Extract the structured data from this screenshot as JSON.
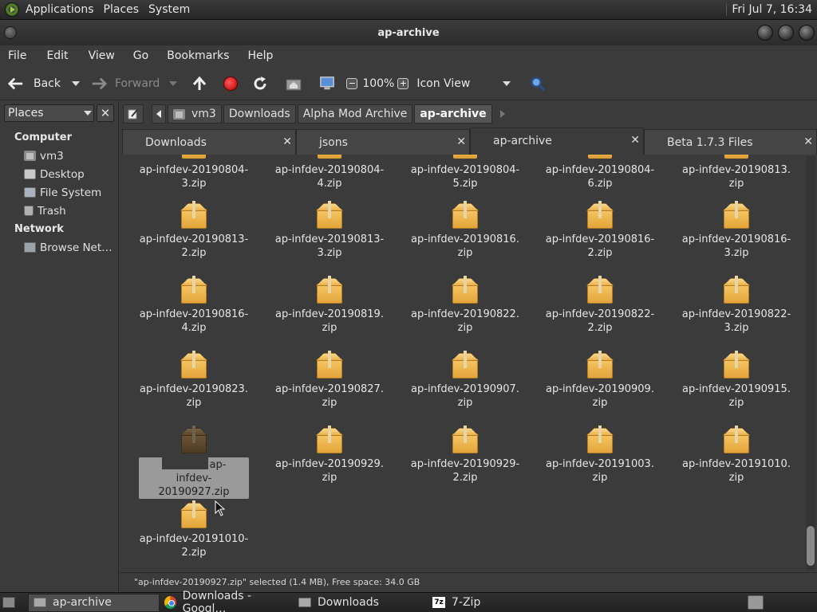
{
  "top_panel": {
    "menus": [
      "Applications",
      "Places",
      "System"
    ],
    "clock": "Fri Jul 7, 16:34"
  },
  "window": {
    "title": "ap-archive"
  },
  "menubar": [
    "File",
    "Edit",
    "View",
    "Go",
    "Bookmarks",
    "Help"
  ],
  "toolbar": {
    "back_label": "Back",
    "forward_label": "Forward",
    "zoom": "100%",
    "view_mode": "Icon View"
  },
  "sidebar": {
    "combo_label": "Places",
    "sections": [
      {
        "title": "Computer",
        "items": [
          {
            "label": "vm3",
            "icon": "home-icon"
          },
          {
            "label": "Desktop",
            "icon": "desktop-icon"
          },
          {
            "label": "File System",
            "icon": "filesystem-icon"
          },
          {
            "label": "Trash",
            "icon": "trash-icon"
          }
        ]
      },
      {
        "title": "Network",
        "items": [
          {
            "label": "Browse Net…",
            "icon": "network-icon"
          }
        ]
      }
    ]
  },
  "pathbar": {
    "crumbs": [
      "vm3",
      "Downloads",
      "Alpha Mod Archive",
      "ap-archive"
    ],
    "active": "ap-archive"
  },
  "tabs": [
    {
      "label": "Downloads",
      "active": false
    },
    {
      "label": "jsons",
      "active": false
    },
    {
      "label": "ap-archive",
      "active": true
    },
    {
      "label": "Beta 1.7.3 Files",
      "active": false
    }
  ],
  "files": [
    {
      "name_l1": "ap-infdev-20190804-",
      "name_l2": "3.zip",
      "partial": true
    },
    {
      "name_l1": "ap-infdev-20190804-",
      "name_l2": "4.zip",
      "partial": true
    },
    {
      "name_l1": "ap-infdev-20190804-",
      "name_l2": "5.zip",
      "partial": true
    },
    {
      "name_l1": "ap-infdev-20190804-",
      "name_l2": "6.zip",
      "partial": true
    },
    {
      "name_l1": "ap-infdev-20190813.",
      "name_l2": "zip",
      "partial": true
    },
    {
      "name_l1": "ap-infdev-20190813-",
      "name_l2": "2.zip"
    },
    {
      "name_l1": "ap-infdev-20190813-",
      "name_l2": "3.zip"
    },
    {
      "name_l1": "ap-infdev-20190816.",
      "name_l2": "zip"
    },
    {
      "name_l1": "ap-infdev-20190816-",
      "name_l2": "2.zip"
    },
    {
      "name_l1": "ap-infdev-20190816-",
      "name_l2": "3.zip"
    },
    {
      "name_l1": "ap-infdev-20190816-",
      "name_l2": "4.zip"
    },
    {
      "name_l1": "ap-infdev-20190819.",
      "name_l2": "zip"
    },
    {
      "name_l1": "ap-infdev-20190822.",
      "name_l2": "zip"
    },
    {
      "name_l1": "ap-infdev-20190822-",
      "name_l2": "2.zip"
    },
    {
      "name_l1": "ap-infdev-20190822-",
      "name_l2": "3.zip"
    },
    {
      "name_l1": "ap-infdev-20190823.",
      "name_l2": "zip"
    },
    {
      "name_l1": "ap-infdev-20190827.",
      "name_l2": "zip"
    },
    {
      "name_l1": "ap-infdev-20190907.",
      "name_l2": "zip"
    },
    {
      "name_l1": "ap-infdev-20190909.",
      "name_l2": "zip"
    },
    {
      "name_l1": "ap-infdev-20190915.",
      "name_l2": "zip"
    },
    {
      "name_l1": "ap-",
      "name_l2": "infdev-20190927.zip",
      "selected": true
    },
    {
      "name_l1": "ap-infdev-20190929.",
      "name_l2": "zip"
    },
    {
      "name_l1": "ap-infdev-20190929-",
      "name_l2": "2.zip"
    },
    {
      "name_l1": "ap-infdev-20191003.",
      "name_l2": "zip"
    },
    {
      "name_l1": "ap-infdev-20191010.",
      "name_l2": "zip"
    },
    {
      "name_l1": "ap-infdev-20191010-",
      "name_l2": "2.zip"
    }
  ],
  "statusbar": "\"ap-infdev-20190927.zip\" selected (1.4 MB), Free space: 34.0 GB",
  "taskbar": {
    "tasks": [
      {
        "label": "ap-archive",
        "icon": "folder-icon",
        "active": true
      },
      {
        "label": "Downloads - Googl…",
        "icon": "chrome-icon",
        "active": false
      },
      {
        "label": "Downloads",
        "icon": "folder-icon",
        "active": false
      },
      {
        "label": "7-Zip",
        "icon": "7zip-icon",
        "active": false
      }
    ],
    "sevenzip_glyph": "7z"
  },
  "colors": {
    "background": "#3b3b3b",
    "archive_icon": "#f0b24a",
    "selection": "#9a9a9a"
  }
}
